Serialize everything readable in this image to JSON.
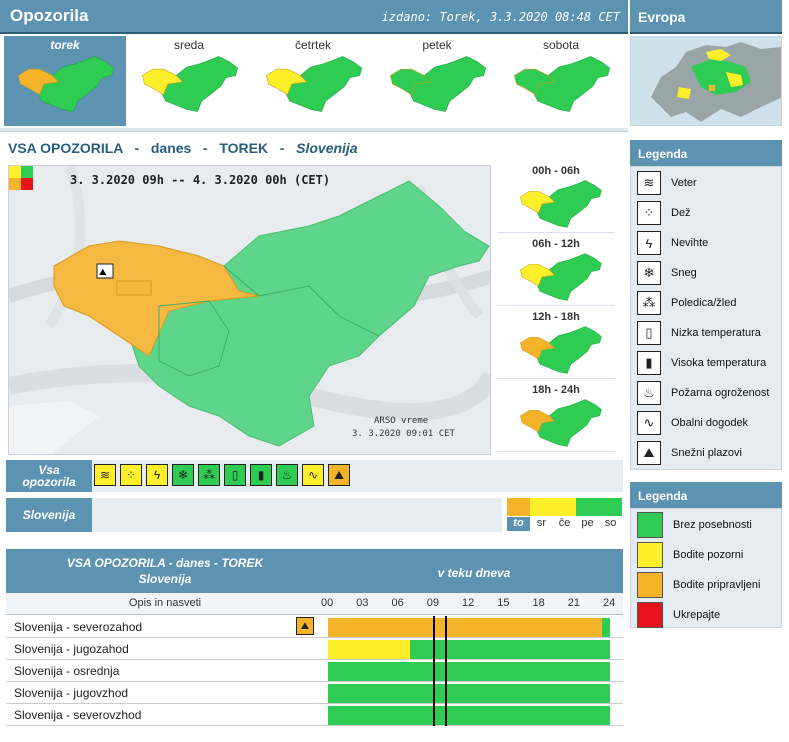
{
  "header": {
    "title": "Opozorila",
    "issued": "izdano: Torek, 3.3.2020 08:48 CET"
  },
  "europe": {
    "title": "Evropa"
  },
  "days": [
    {
      "label": "torek",
      "active": true,
      "level": "orange"
    },
    {
      "label": "sreda",
      "active": false,
      "level": "yellow"
    },
    {
      "label": "četrtek",
      "active": false,
      "level": "yellow"
    },
    {
      "label": "petek",
      "active": false,
      "level": "green"
    },
    {
      "label": "sobota",
      "active": false,
      "level": "green"
    }
  ],
  "main": {
    "title_parts": [
      "VSA OPOZORILA",
      "-",
      "danes",
      "-",
      "TOREK",
      "-",
      "Slovenija"
    ],
    "period": "3. 3.2020  09h  --  4. 3.2020  00h    (CET)",
    "credit_line1": "ARSO vreme",
    "credit_line2": "3. 3.2020  09:01 CET"
  },
  "periods": [
    {
      "label": "00h - 06h"
    },
    {
      "label": "06h - 12h"
    },
    {
      "label": "12h - 18h"
    },
    {
      "label": "18h - 24h"
    }
  ],
  "hazard_row": {
    "label": "Vsa opozorila",
    "icons": [
      {
        "name": "wind-icon",
        "glyph": "≋",
        "color": "#ffef2a"
      },
      {
        "name": "rain-icon",
        "glyph": "⁘",
        "color": "#ffef2a"
      },
      {
        "name": "thunderstorm-icon",
        "glyph": "ϟ",
        "color": "#ffef2a"
      },
      {
        "name": "snow-icon",
        "glyph": "❄",
        "color": "#2ecc53"
      },
      {
        "name": "freezing-rain-icon",
        "glyph": "⁂",
        "color": "#2ecc53"
      },
      {
        "name": "low-temperature-icon",
        "glyph": "▯",
        "color": "#2ecc53"
      },
      {
        "name": "high-temperature-icon",
        "glyph": "▮",
        "color": "#2ecc53"
      },
      {
        "name": "fire-danger-icon",
        "glyph": "♨",
        "color": "#2ecc53"
      },
      {
        "name": "coastal-event-icon",
        "glyph": "∿",
        "color": "#ffef2a"
      },
      {
        "name": "avalanche-icon",
        "glyph": "⛰",
        "color": "#f5b32a"
      }
    ]
  },
  "slovenija_row": {
    "label": "Slovenija",
    "forecast": [
      {
        "label": "to",
        "color": "#f5b32a",
        "active": true
      },
      {
        "label": "sr",
        "color": "#ffef2a",
        "active": false
      },
      {
        "label": "če",
        "color": "#ffef2a",
        "active": false
      },
      {
        "label": "pe",
        "color": "#2ecc53",
        "active": false
      },
      {
        "label": "so",
        "color": "#2ecc53",
        "active": false
      }
    ]
  },
  "legend_types": {
    "title": "Legenda",
    "items": [
      {
        "label": "Veter",
        "icon": "wind-icon",
        "glyph": "≋"
      },
      {
        "label": "Dež",
        "icon": "rain-icon",
        "glyph": "⁘"
      },
      {
        "label": "Nevihte",
        "icon": "thunderstorm-icon",
        "glyph": "ϟ"
      },
      {
        "label": "Sneg",
        "icon": "snow-icon",
        "glyph": "❄"
      },
      {
        "label": "Poledica/žled",
        "icon": "freezing-rain-icon",
        "glyph": "⁂"
      },
      {
        "label": "Nizka temperatura",
        "icon": "low-temperature-icon",
        "glyph": "▯"
      },
      {
        "label": "Visoka temperatura",
        "icon": "high-temperature-icon",
        "glyph": "▮"
      },
      {
        "label": "Požarna ogroženost",
        "icon": "fire-danger-icon",
        "glyph": "♨"
      },
      {
        "label": "Obalni dogodek",
        "icon": "coastal-event-icon",
        "glyph": "∿"
      },
      {
        "label": "Snežni plazovi",
        "icon": "avalanche-icon",
        "glyph": "⛰"
      }
    ]
  },
  "legend_levels": {
    "title": "Legenda",
    "items": [
      {
        "label": "Brez posebnosti",
        "color": "#2ecc53"
      },
      {
        "label": "Bodite pozorni",
        "color": "#ffef2a"
      },
      {
        "label": "Bodite pripravljeni",
        "color": "#f5b32a"
      },
      {
        "label": "Ukrepajte",
        "color": "#e8141b"
      }
    ]
  },
  "table": {
    "title_line1": "VSA OPOZORILA - danes - TOREK",
    "title_line2": "Slovenija",
    "right_title": "v teku dneva",
    "col_label": "Opis in nasveti",
    "hours": [
      "00",
      "03",
      "06",
      "09",
      "12",
      "15",
      "18",
      "21",
      "24"
    ],
    "current_hours": [
      9,
      10
    ],
    "rows": [
      {
        "name": "Slovenija - severozahod",
        "icon": "avalanche-icon",
        "segments": [
          {
            "from": 0,
            "to": 23.3,
            "color": "#f5b32a"
          },
          {
            "from": 23.3,
            "to": 24,
            "color": "#2ecc53"
          }
        ]
      },
      {
        "name": "Slovenija - jugozahod",
        "icon": "",
        "segments": [
          {
            "from": 0,
            "to": 7,
            "color": "#ffef2a"
          },
          {
            "from": 7,
            "to": 24,
            "color": "#2ecc53"
          }
        ]
      },
      {
        "name": "Slovenija - osrednja",
        "icon": "",
        "segments": [
          {
            "from": 0,
            "to": 24,
            "color": "#2ecc53"
          }
        ]
      },
      {
        "name": "Slovenija - jugovzhod",
        "icon": "",
        "segments": [
          {
            "from": 0,
            "to": 24,
            "color": "#2ecc53"
          }
        ]
      },
      {
        "name": "Slovenija - severovzhod",
        "icon": "",
        "segments": [
          {
            "from": 0,
            "to": 24,
            "color": "#2ecc53"
          }
        ]
      }
    ]
  },
  "colors": {
    "accent": "#5b93b1",
    "green": "#2ecc53",
    "yellow": "#ffef2a",
    "orange": "#f5b32a",
    "red": "#e8141b"
  }
}
